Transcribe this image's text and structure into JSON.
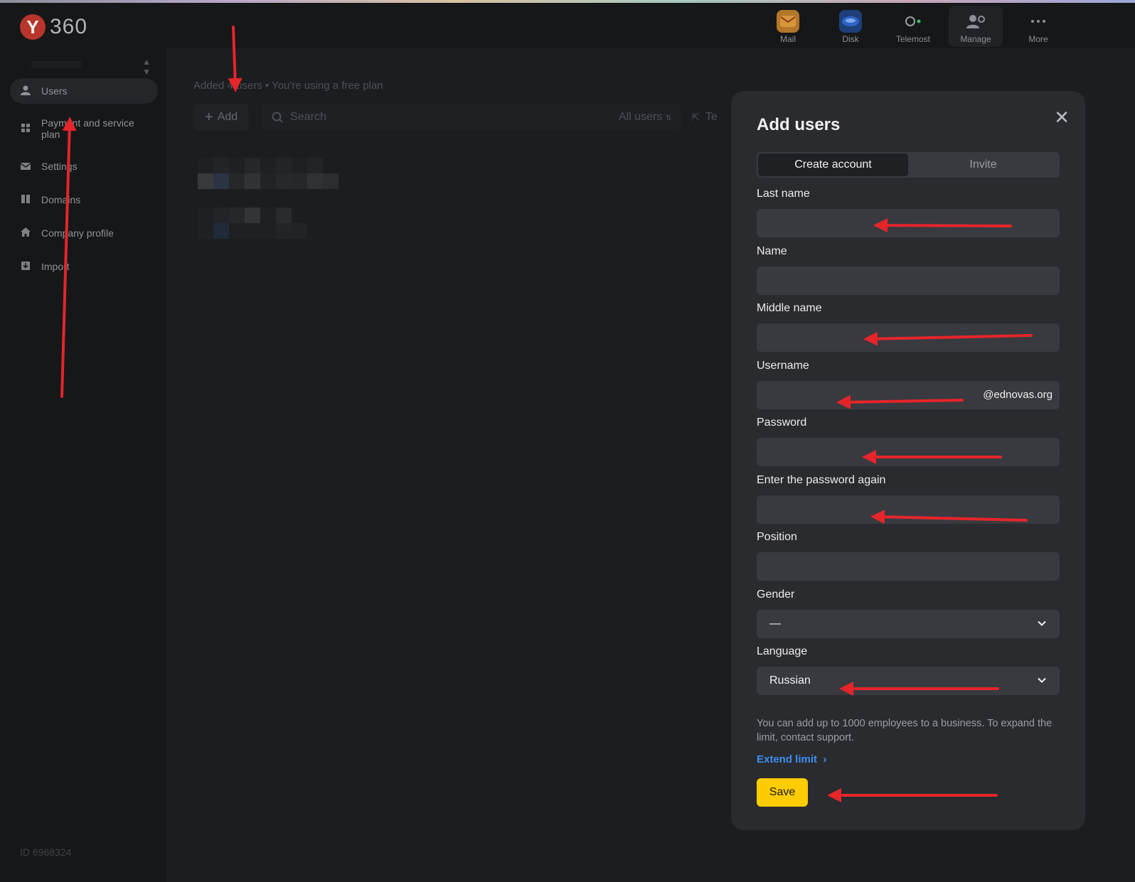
{
  "header": {
    "logo_letter": "Y",
    "logo_number": "360",
    "apps": [
      {
        "label": "Mail",
        "icon": "mail-icon",
        "color": "#e8a23a"
      },
      {
        "label": "Disk",
        "icon": "disk-icon",
        "color": "#2c64c8"
      },
      {
        "label": "Telemost",
        "icon": "telemost-icon",
        "color": "#3ac25c"
      },
      {
        "label": "Manage",
        "icon": "manage-icon",
        "color": "#8d9095"
      },
      {
        "label": "More",
        "icon": "more-icon",
        "color": "#8d9095"
      }
    ]
  },
  "sidebar": {
    "items": [
      {
        "label": "Users",
        "icon": "user-icon"
      },
      {
        "label": "Payment and service plan",
        "icon": "grid-icon"
      },
      {
        "label": "Settings",
        "icon": "mail-settings-icon"
      },
      {
        "label": "Domains",
        "icon": "domains-icon"
      },
      {
        "label": "Company profile",
        "icon": "home-icon"
      },
      {
        "label": "Import",
        "icon": "import-icon"
      }
    ],
    "org_id": "ID 6968324"
  },
  "main": {
    "breadcrumb": "Added 4 users • You're using a free plan",
    "add_label": "Add",
    "search_placeholder": "Search",
    "filter_label": "All users",
    "export_label": "Te"
  },
  "modal": {
    "title": "Add users",
    "tabs": [
      {
        "label": "Create account",
        "active": true
      },
      {
        "label": "Invite",
        "active": false
      }
    ],
    "fields": {
      "last_name": {
        "label": "Last name",
        "value": ""
      },
      "name": {
        "label": "Name",
        "value": ""
      },
      "middle_name": {
        "label": "Middle name",
        "value": ""
      },
      "username": {
        "label": "Username",
        "value": "",
        "suffix": "@ednovas.org"
      },
      "password": {
        "label": "Password",
        "value": ""
      },
      "password_again": {
        "label": "Enter the password again",
        "value": ""
      },
      "position": {
        "label": "Position",
        "value": ""
      },
      "gender": {
        "label": "Gender",
        "value": "—"
      },
      "language": {
        "label": "Language",
        "value": "Russian"
      }
    },
    "note": "You can add up to 1000 employees to a business. To expand the limit, contact support.",
    "extend_label": "Extend limit",
    "save_label": "Save"
  },
  "colors": {
    "accent_yellow": "#ffcc00",
    "link_blue": "#3d8ef0",
    "annotation_red": "#e5252a"
  }
}
